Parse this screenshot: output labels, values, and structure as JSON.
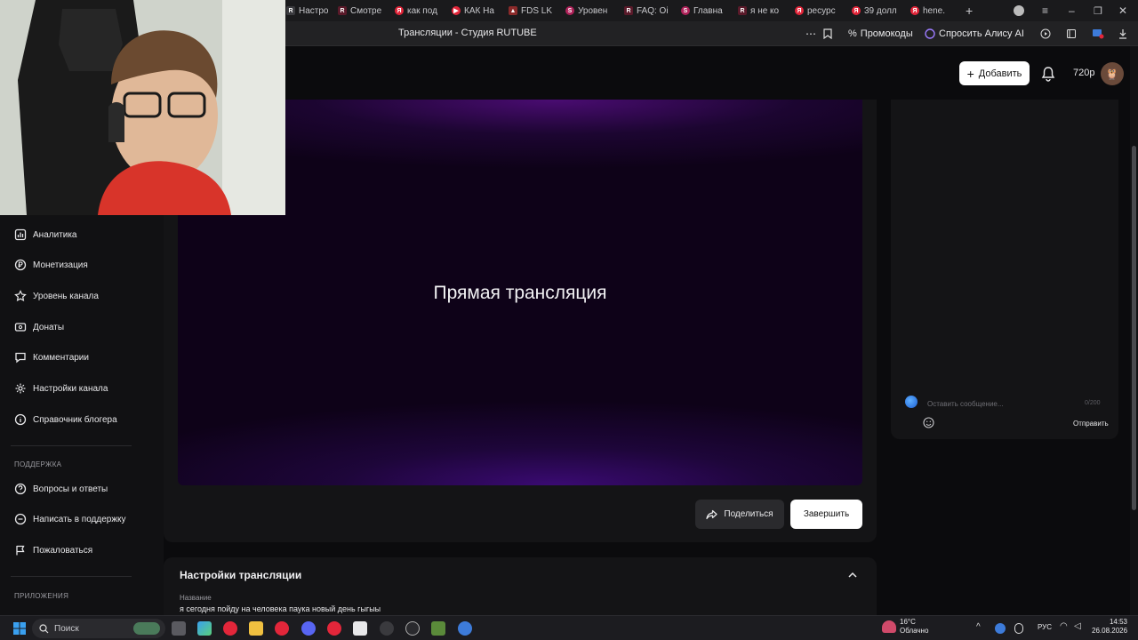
{
  "browser": {
    "tabs": [
      "Настрой",
      "Смотре",
      "как под",
      "КАК Ha",
      "FDS LK",
      "Уровен",
      "FAQ: Oi",
      "Главна",
      "я не ко",
      "ресурс",
      "39 долл",
      "hene."
    ],
    "page_title": "Трансляции - Студия RUTUBE",
    "promo_label": "Промокоды",
    "alice_label": "Спросить Алису AI"
  },
  "header": {
    "add_label": "Добавить",
    "quality": "720p"
  },
  "sidebar": {
    "items": [
      {
        "label": "Аналитика",
        "icon": "analytics-icon"
      },
      {
        "label": "Монетизация",
        "icon": "ruble-icon"
      },
      {
        "label": "Уровень канала",
        "icon": "star-icon"
      },
      {
        "label": "Донаты",
        "icon": "donate-icon"
      },
      {
        "label": "Комментарии",
        "icon": "comment-icon"
      },
      {
        "label": "Настройки канала",
        "icon": "gear-icon"
      },
      {
        "label": "Справочник блогера",
        "icon": "info-icon"
      }
    ],
    "support_heading": "ПОДДЕРЖКА",
    "support_items": [
      {
        "label": "Вопросы и ответы",
        "icon": "question-icon"
      },
      {
        "label": "Написать в поддержку",
        "icon": "chat-icon"
      },
      {
        "label": "Пожаловаться",
        "icon": "flag-icon"
      }
    ],
    "apps_heading": "ПРИЛОЖЕНИЯ"
  },
  "player": {
    "label": "Прямая трансляция"
  },
  "actions": {
    "share_label": "Поделиться",
    "finish_label": "Завершить"
  },
  "settings": {
    "title": "Настройки трансляции",
    "name_label": "Название",
    "name_value": "я сегодня пойду на человека паука новый день гыгыы"
  },
  "chat": {
    "placeholder": "Оставить сообщение...",
    "counter": "0/200",
    "send_label": "Отправить"
  },
  "taskbar": {
    "search_label": "Поиск",
    "weather_temp": "16°C",
    "weather_desc": "Облачно",
    "lang": "РУС",
    "time": "14:53",
    "date": "26.08.2026"
  },
  "colors": {
    "accent_purple": "#3a0a72",
    "rutube_red": "#e3263a"
  }
}
